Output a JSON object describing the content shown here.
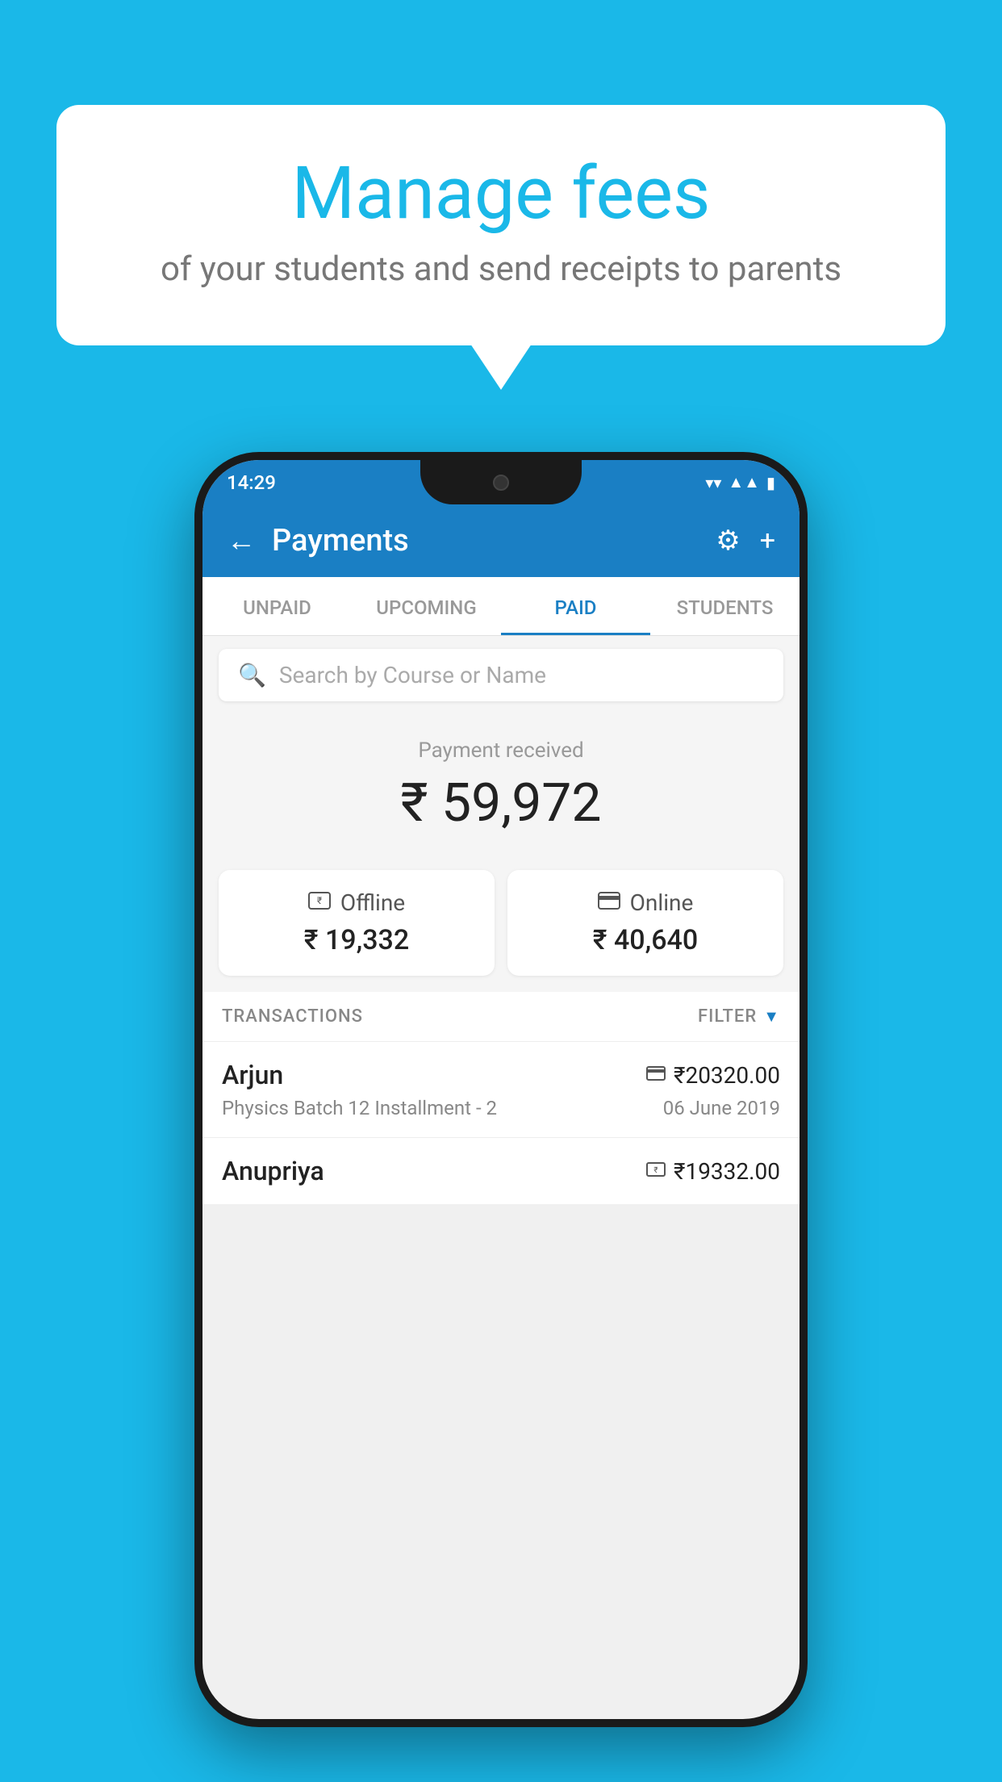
{
  "background_color": "#1ab8e8",
  "speech_bubble": {
    "heading": "Manage fees",
    "subtext": "of your students and send receipts to parents"
  },
  "status_bar": {
    "time": "14:29",
    "wifi": "▼",
    "signal": "▲",
    "battery": "▮"
  },
  "header": {
    "title": "Payments",
    "back_label": "←",
    "gear_label": "⚙",
    "plus_label": "+"
  },
  "tabs": [
    {
      "id": "unpaid",
      "label": "UNPAID",
      "active": false
    },
    {
      "id": "upcoming",
      "label": "UPCOMING",
      "active": false
    },
    {
      "id": "paid",
      "label": "PAID",
      "active": true
    },
    {
      "id": "students",
      "label": "STUDENTS",
      "active": false
    }
  ],
  "search": {
    "placeholder": "Search by Course or Name"
  },
  "payment_received": {
    "label": "Payment received",
    "amount": "₹ 59,972"
  },
  "payment_cards": [
    {
      "id": "offline",
      "label": "Offline",
      "amount": "₹ 19,332",
      "icon": "💳"
    },
    {
      "id": "online",
      "label": "Online",
      "amount": "₹ 40,640",
      "icon": "💳"
    }
  ],
  "transactions_label": "TRANSACTIONS",
  "filter_label": "FILTER",
  "transactions": [
    {
      "name": "Arjun",
      "course": "Physics Batch 12 Installment - 2",
      "amount": "₹20320.00",
      "date": "06 June 2019",
      "payment_type": "online"
    },
    {
      "name": "Anupriya",
      "course": "",
      "amount": "₹19332.00",
      "date": "",
      "payment_type": "offline"
    }
  ]
}
